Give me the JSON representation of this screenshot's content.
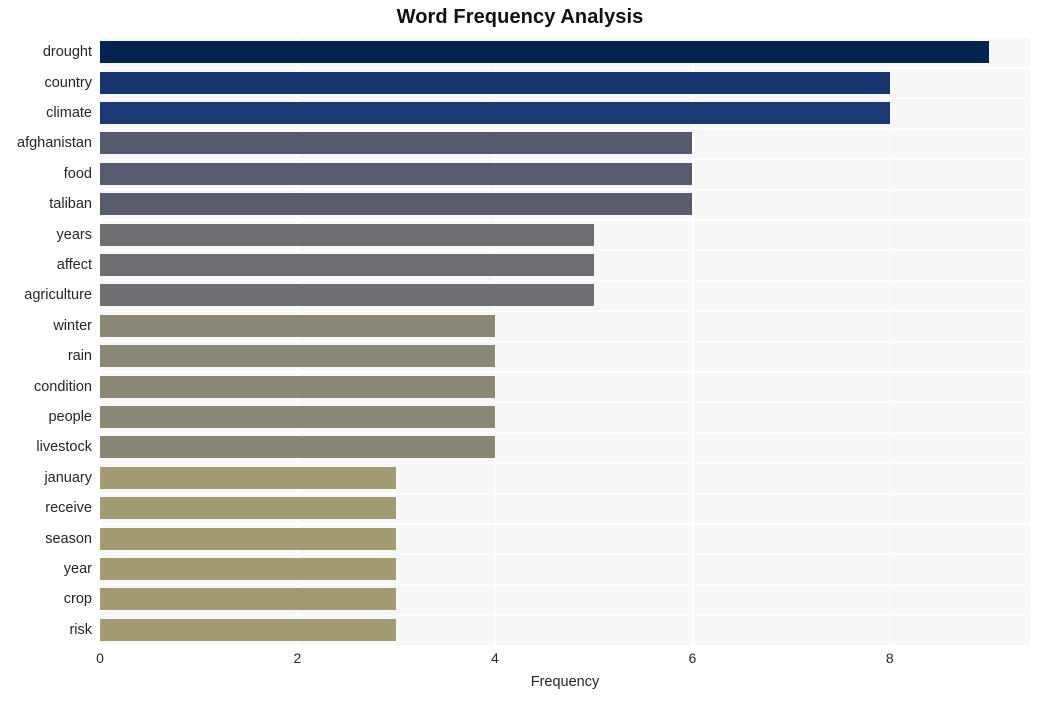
{
  "chart_data": {
    "type": "bar",
    "orientation": "horizontal",
    "title": "Word Frequency Analysis",
    "xlabel": "Frequency",
    "ylabel": "",
    "xlim": [
      0,
      9.42
    ],
    "xticks": [
      0,
      2,
      4,
      6,
      8
    ],
    "grid": true,
    "legend": "none",
    "categories": [
      "drought",
      "country",
      "climate",
      "afghanistan",
      "food",
      "taliban",
      "years",
      "affect",
      "agriculture",
      "winter",
      "rain",
      "condition",
      "people",
      "livestock",
      "january",
      "receive",
      "season",
      "year",
      "crop",
      "risk"
    ],
    "values": [
      9,
      8,
      8,
      6,
      6,
      6,
      5,
      5,
      5,
      4,
      4,
      4,
      4,
      4,
      3,
      3,
      3,
      3,
      3,
      3
    ],
    "bar_colors": [
      "#04244f",
      "#17356f",
      "#1b3a73",
      "#565a6d",
      "#585c6e",
      "#585c6e",
      "#6d6e71",
      "#6d6e71",
      "#6f7073",
      "#8b8876",
      "#8b8876",
      "#8b8876",
      "#8a8775",
      "#888573",
      "#a39a72",
      "#a39a72",
      "#a39a72",
      "#a39a72",
      "#a39a72",
      "#a39a72"
    ]
  },
  "style": {
    "plot_background": "#f7f7f7",
    "grid_color": "#ffffff",
    "figure_background": "#ffffff",
    "title_color": "#101010",
    "tick_color": "#262626"
  }
}
